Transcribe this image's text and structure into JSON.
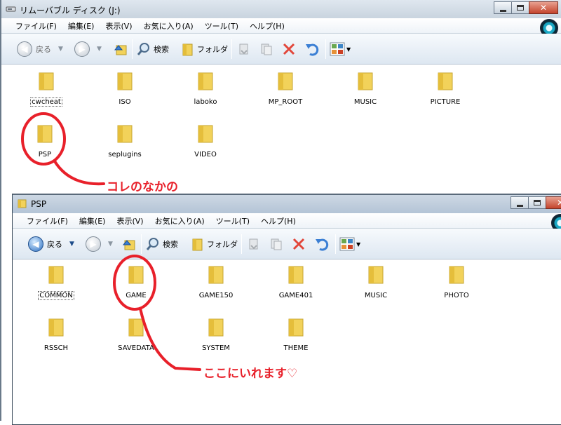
{
  "window1": {
    "title": "リムーバブル ディスク (J:)",
    "menu": [
      "ファイル(F)",
      "編集(E)",
      "表示(V)",
      "お気に入り(A)",
      "ツール(T)",
      "ヘルプ(H)"
    ],
    "toolbar": {
      "back_label": "戻る",
      "search_label": "検索",
      "folders_label": "フォルダ"
    },
    "items": [
      "cwcheat",
      "ISO",
      "laboko",
      "MP_ROOT",
      "MUSIC",
      "PICTURE",
      "PSP",
      "seplugins",
      "VIDEO"
    ]
  },
  "window2": {
    "title": "PSP",
    "menu": [
      "ファイル(F)",
      "編集(E)",
      "表示(V)",
      "お気に入り(A)",
      "ツール(T)",
      "ヘルプ(H)"
    ],
    "toolbar": {
      "back_label": "戻る",
      "search_label": "検索",
      "folders_label": "フォルダ"
    },
    "items": [
      "COMMON",
      "GAME",
      "GAME150",
      "GAME401",
      "MUSIC",
      "PHOTO",
      "RSSCH",
      "SAVEDATA",
      "SYSTEM",
      "THEME"
    ]
  },
  "annotations": {
    "note1": "コレのなかの",
    "note2": "ここにいれます♡"
  },
  "colors": {
    "annotation": "#e8202a",
    "folder": "#f2d25a"
  }
}
